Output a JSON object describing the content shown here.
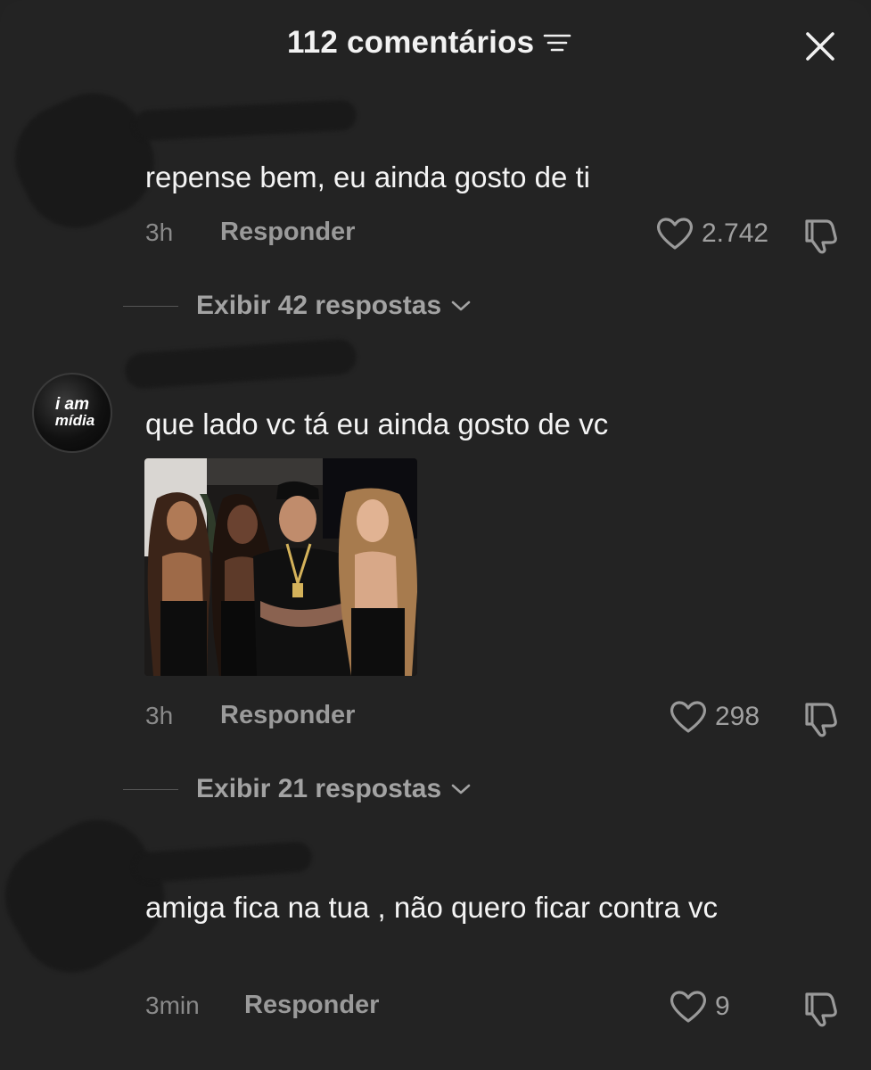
{
  "header": {
    "title": "112 comentários",
    "filter_icon": "filter-icon",
    "close_icon": "close-icon"
  },
  "comments": [
    {
      "text": "repense bem, eu ainda gosto de ti",
      "time": "3h",
      "reply_label": "Responder",
      "likes": "2.742",
      "view_replies": "Exibir 42 respostas"
    },
    {
      "avatar_text_line1": "i am",
      "avatar_text_line2": "mídia",
      "text": "que lado vc tá eu ainda gosto de vc",
      "has_photo": true,
      "time": "3h",
      "reply_label": "Responder",
      "likes": "298",
      "view_replies": "Exibir 21 respostas"
    },
    {
      "text": "amiga fica na tua , não quero ficar contra vc",
      "time": "3min",
      "reply_label": "Responder",
      "likes": "9"
    }
  ],
  "colors": {
    "background": "#232323",
    "text_primary": "#f4f4f4",
    "text_secondary": "#8a8a8a"
  }
}
